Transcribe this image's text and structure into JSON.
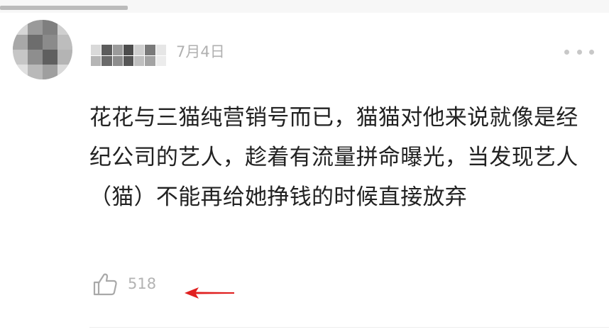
{
  "comment": {
    "date": "7月4日",
    "text": "花花与三猫纯营销号而已，猫猫对他来说就像是经纪公司的艺人，趁着有流量拼命曝光，当发现艺人（猫）不能再给她挣钱的时候直接放弃",
    "likes": "518",
    "icons": {
      "more": "more-dots-icon",
      "like": "thumbs-up-icon",
      "annotation": "red-arrow-left-icon"
    },
    "colors": {
      "text": "#222222",
      "meta": "#b0b0b0",
      "annotation": "#e02020"
    }
  }
}
